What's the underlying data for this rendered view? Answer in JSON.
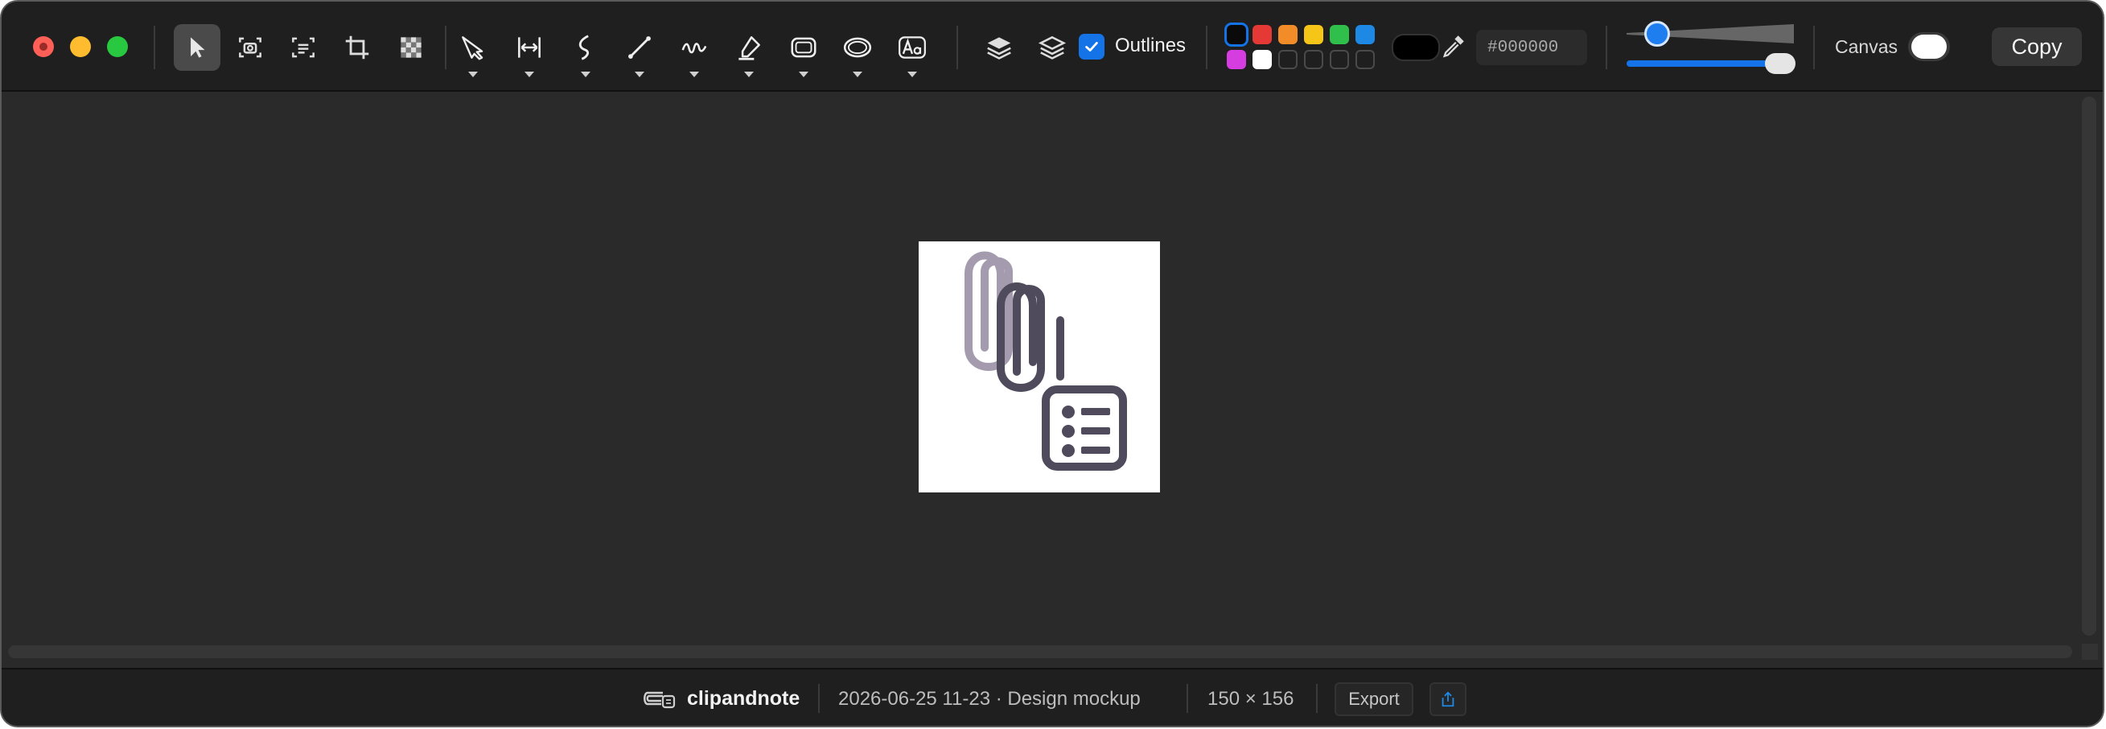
{
  "toolbar": {
    "outlines_label": "Outlines",
    "outlines_checked": true,
    "hex_value": "#000000",
    "canvas_label": "Canvas",
    "copy_label": "Copy",
    "swatches_row1": [
      "#0a0a0a",
      "#e53935",
      "#f28c28",
      "#f5c518",
      "#2fbf4a",
      "#1e88e5"
    ],
    "swatches_row2": [
      "#d63de0",
      "#ffffff",
      "empty",
      "empty",
      "empty",
      "empty"
    ],
    "selected_color": "#000000",
    "tools": [
      "select-arrow",
      "camera-capture",
      "text-recognition",
      "crop",
      "pixelate",
      "arrow",
      "measure",
      "curve",
      "line",
      "freehand",
      "highlighter",
      "rounded-rect",
      "ellipse",
      "text"
    ]
  },
  "canvas": {
    "image_subject": "paperclips-and-note-icon"
  },
  "footer": {
    "app_name": "clipandnote",
    "title": "2026-06-25 11-23 · Design mockup",
    "dimensions": "150 × 156",
    "export_label": "Export"
  }
}
